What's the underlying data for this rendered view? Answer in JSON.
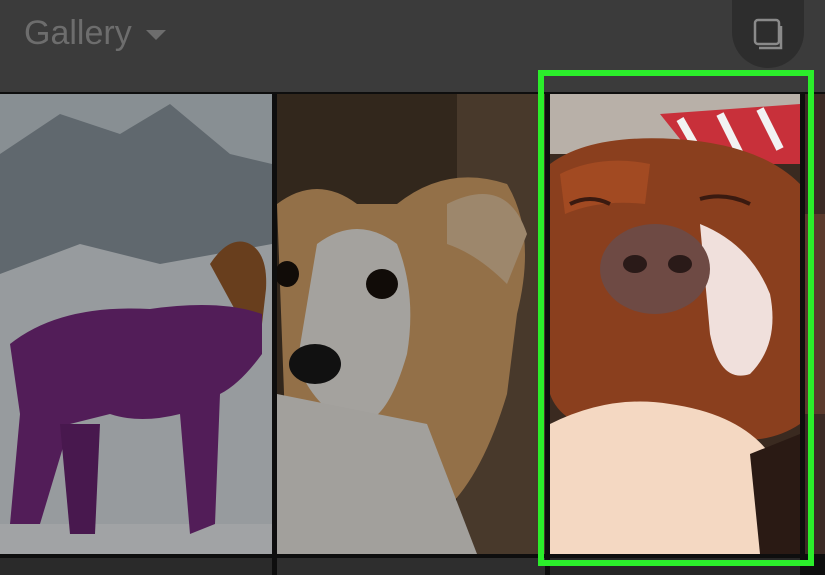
{
  "header": {
    "title": "Gallery",
    "dropdown_icon": "caret-down-icon",
    "multi_select_icon": "multi-select-icon"
  },
  "gallery": {
    "photos": [
      {
        "subject": "dog-in-purple-snowsuit",
        "selected": false
      },
      {
        "subject": "corgi",
        "selected": false
      },
      {
        "subject": "sleeping-pit-bull",
        "selected": true
      },
      {
        "subject": "partial-photo",
        "selected": false
      }
    ]
  },
  "colors": {
    "header_bg": "#3b3b3b",
    "title_text": "#6d6d6d",
    "selection_highlight": "#2bee2b"
  }
}
